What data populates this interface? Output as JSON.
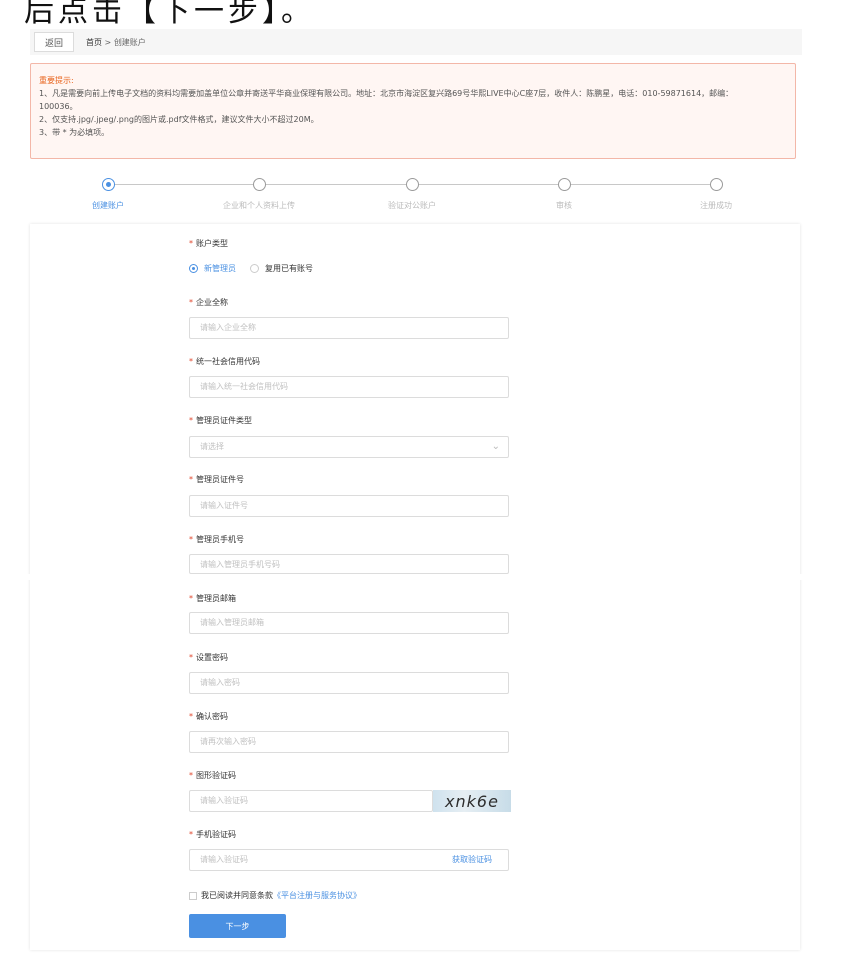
{
  "top_text": "后点击【下一步】。",
  "topbar": {
    "back_label": "返回",
    "breadcrumb_home": "首页",
    "breadcrumb_sep": " > ",
    "breadcrumb_current": "创建账户"
  },
  "notice": {
    "title": "重要提示:",
    "lines": [
      "1、凡是需要向前上传电子文档的资料均需要加盖单位公章并寄送平华商业保理有限公司。地址：北京市海淀区复兴路69号华熙LIVE中心C座7层，收件人：陈鹏星，电话：010-59871614，邮编：",
      "100036。",
      "2、仅支持.jpg/.jpeg/.png的图片或.pdf文件格式，建议文件大小不超过20M。",
      "3、带 * 为必填项。"
    ]
  },
  "steps": [
    {
      "label": "创建账户",
      "active": true
    },
    {
      "label": "企业和个人资料上传",
      "active": false
    },
    {
      "label": "验证对公账户",
      "active": false
    },
    {
      "label": "审核",
      "active": false
    },
    {
      "label": "注册成功",
      "active": false
    }
  ],
  "form": {
    "account_type_label": "账户类型",
    "radio_new": "新管理员",
    "radio_existing": "复用已有账号",
    "company_name_label": "企业全称",
    "company_name_placeholder": "请输入企业全称",
    "credit_code_label": "统一社会信用代码",
    "credit_code_placeholder": "请输入统一社会信用代码",
    "id_type_label": "管理员证件类型",
    "id_type_placeholder": "请选择",
    "id_number_label": "管理员证件号",
    "id_number_placeholder": "请输入证件号",
    "phone_label": "管理员手机号",
    "phone_placeholder": "请输入管理员手机号码",
    "email_label": "管理员邮箱",
    "email_placeholder": "请输入管理员邮箱",
    "password_label": "设置密码",
    "password_placeholder": "请输入密码",
    "confirm_label": "确认密码",
    "confirm_placeholder": "请再次输入密码",
    "captcha_label": "图形验证码",
    "captcha_placeholder": "请输入验证码",
    "captcha_text": "xnk6e",
    "sms_label": "手机验证码",
    "sms_placeholder": "请输入验证码",
    "sms_link": "获取验证码",
    "agree_text": "我已阅读并同意条款",
    "agree_link": "《平台注册与服务协议》",
    "next_label": "下一步"
  },
  "colors": {
    "accent": "#4a90e2",
    "required": "#e0452b",
    "notice_title": "#e8651f"
  }
}
